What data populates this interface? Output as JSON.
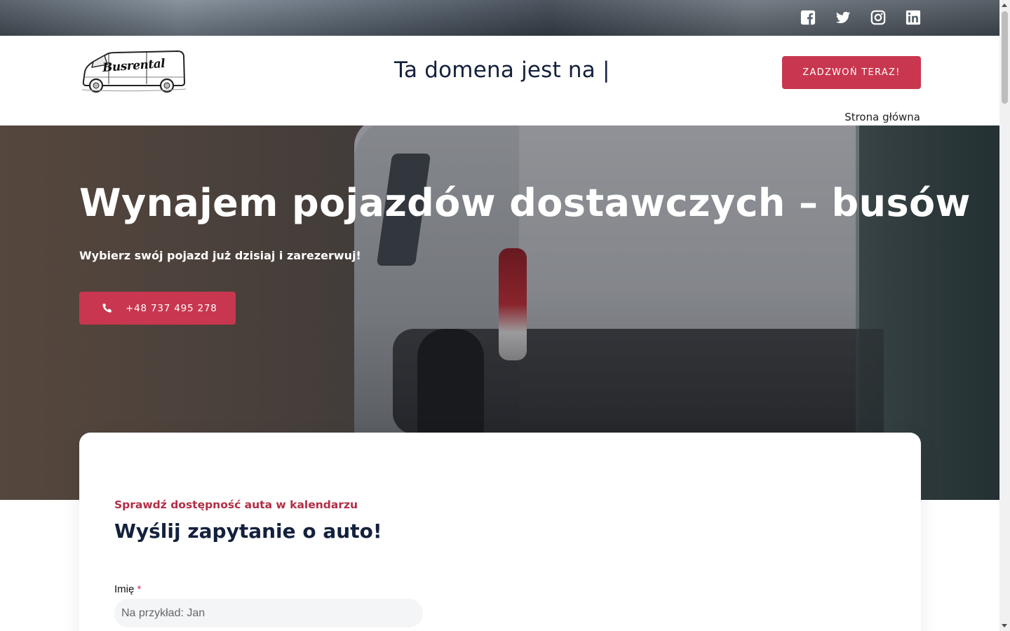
{
  "social": {
    "items": [
      {
        "name": "facebook",
        "icon": "facebook-icon"
      },
      {
        "name": "twitter",
        "icon": "twitter-icon"
      },
      {
        "name": "instagram",
        "icon": "instagram-icon"
      },
      {
        "name": "linkedin",
        "icon": "linkedin-icon"
      }
    ]
  },
  "header": {
    "logo_text": "Busrental",
    "domain_text": "Ta domena jest na |",
    "cta_label": "ZADZWOŃ TERAZ!",
    "nav_home": "Strona główna"
  },
  "hero": {
    "title": "Wynajem pojazdów dostawczych – busów",
    "subtitle": "Wybierz swój pojazd już dzisiaj i zarezerwuj!",
    "phone_label": "+48 737 495 278"
  },
  "form": {
    "eyebrow": "Sprawdź dostępność auta w kalendarzu",
    "title": "Wyślij zapytanie o auto!",
    "name_label": "Imię",
    "name_required_mark": "*",
    "name_placeholder": "Na przykład: Jan"
  },
  "colors": {
    "accent": "#c8374f",
    "heading": "#14213d",
    "eyebrow": "#b32d45"
  }
}
